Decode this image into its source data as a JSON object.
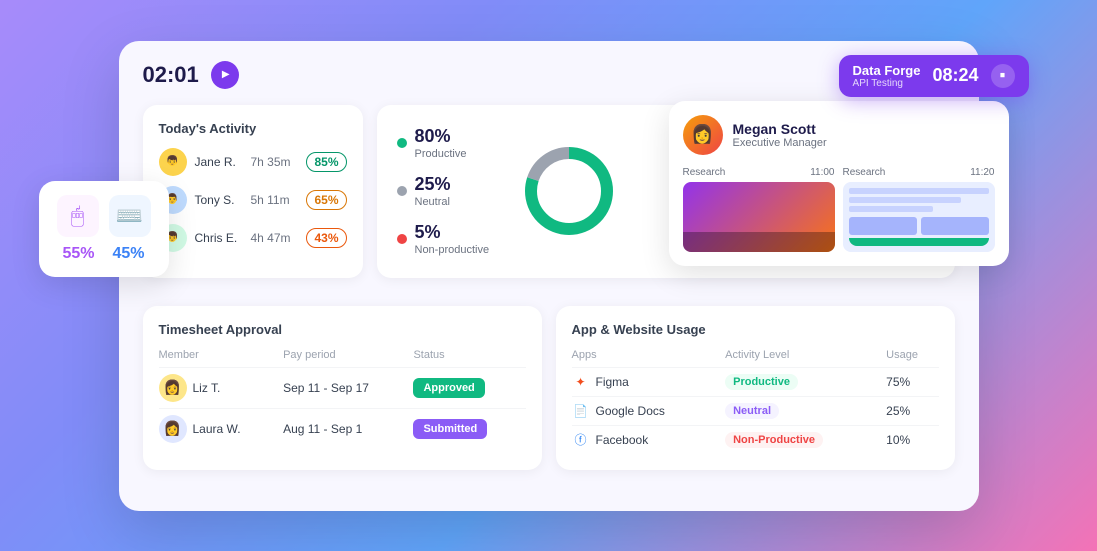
{
  "main": {
    "timer": "02:01",
    "forge_badge": {
      "name": "Data Forge",
      "sub": "API Testing",
      "time": "08:24"
    }
  },
  "activity": {
    "title": "Today's Activity",
    "members": [
      {
        "name": "Jane R.",
        "time": "7h 35m",
        "percent": "85%",
        "style": "green"
      },
      {
        "name": "Tony S.",
        "time": "5h 11m",
        "percent": "65%",
        "style": "yellow"
      },
      {
        "name": "Chris E.",
        "time": "4h 47m",
        "percent": "43%",
        "style": "orange"
      }
    ]
  },
  "productivity": {
    "items": [
      {
        "label": "Productive",
        "percent": "80%",
        "dot": "green"
      },
      {
        "label": "Neutral",
        "percent": "25%",
        "dot": "gray"
      },
      {
        "label": "Non-productive",
        "percent": "5%",
        "dot": "red"
      }
    ],
    "donut": {
      "productive": 80,
      "neutral": 25,
      "non_productive": 5
    }
  },
  "input_card": {
    "mouse_percent": "55%",
    "keyboard_percent": "45%"
  },
  "profile": {
    "name": "Megan Scott",
    "role": "Executive Manager",
    "screenshots": [
      {
        "label": "Research",
        "time": "11:00"
      },
      {
        "label": "Research",
        "time": "11:20"
      }
    ]
  },
  "timesheet": {
    "title": "Timesheet Approval",
    "headers": [
      "Member",
      "Pay period",
      "Status"
    ],
    "rows": [
      {
        "name": "Liz T.",
        "period": "Sep 11 - Sep 17",
        "status": "Approved",
        "style": "approved"
      },
      {
        "name": "Laura W.",
        "period": "Aug 11 - Sep 1",
        "status": "Submitted",
        "style": "submitted"
      }
    ]
  },
  "app_usage": {
    "title": "App & Website Usage",
    "headers": [
      "Apps",
      "Activity Level",
      "Usage"
    ],
    "rows": [
      {
        "name": "Figma",
        "level": "Productive",
        "usage": "75%",
        "level_style": "productive",
        "icon": "🎨"
      },
      {
        "name": "Google Docs",
        "level": "Neutral",
        "usage": "25%",
        "level_style": "neutral",
        "icon": "📄"
      },
      {
        "name": "Facebook",
        "level": "Non-Productive",
        "usage": "10%",
        "level_style": "nonproductive",
        "icon": "📘"
      }
    ]
  }
}
